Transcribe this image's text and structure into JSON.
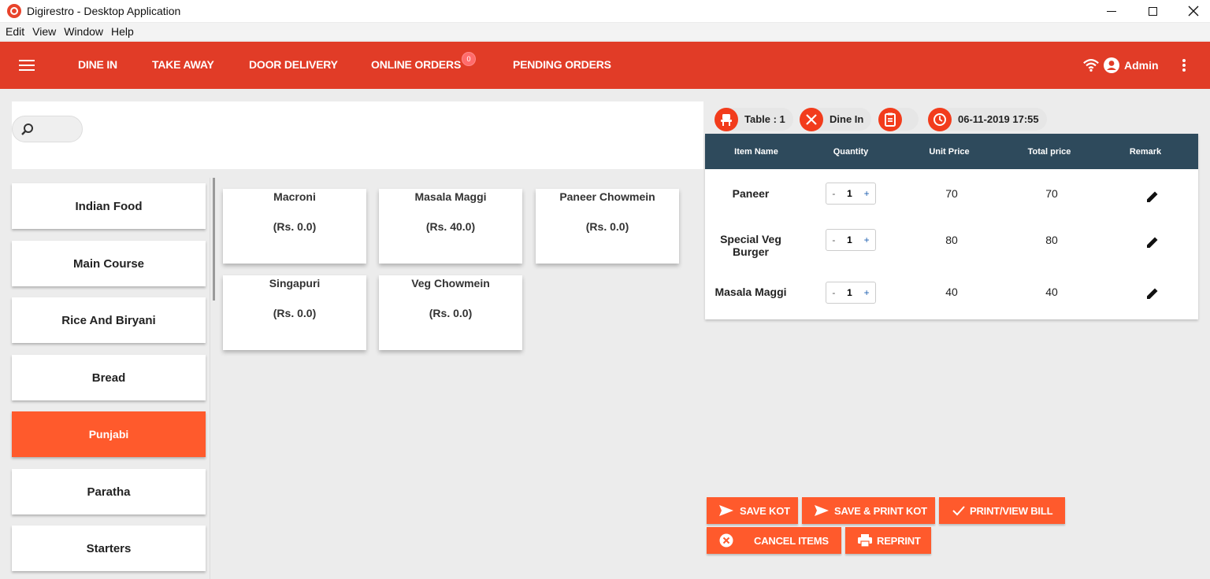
{
  "window": {
    "title": "Digirestro - Desktop Application"
  },
  "menu": [
    "Edit",
    "View",
    "Window",
    "Help"
  ],
  "nav": {
    "tabs": [
      "DINE IN",
      "TAKE AWAY",
      "DOOR DELIVERY",
      "ONLINE ORDERS",
      "PENDING ORDERS"
    ],
    "online_badge": "0",
    "user": "Admin"
  },
  "categories": [
    "Indian Food",
    "Main Course",
    "Rice And Biryani",
    "Bread",
    "Punjabi",
    "Paratha",
    "Starters"
  ],
  "active_category": "Punjabi",
  "products": [
    {
      "name": "Macroni",
      "price": "(Rs. 0.0)"
    },
    {
      "name": "Masala Maggi",
      "price": "(Rs. 40.0)"
    },
    {
      "name": "Paneer Chowmein",
      "price": "(Rs. 0.0)"
    },
    {
      "name": "Singapuri",
      "price": "(Rs. 0.0)"
    },
    {
      "name": "Veg Chowmein",
      "price": "(Rs. 0.0)"
    }
  ],
  "order_info": {
    "table": "Table : 1",
    "mode": "Dine In",
    "datetime": "06-11-2019 17:55"
  },
  "order_table": {
    "headers": [
      "Item Name",
      "Quantity",
      "Unit Price",
      "Total price",
      "Remark"
    ],
    "rows": [
      {
        "name": "Paneer",
        "qty": "1",
        "unit": "70",
        "total": "70"
      },
      {
        "name": "Special Veg Burger",
        "qty": "1",
        "unit": "80",
        "total": "80"
      },
      {
        "name": "Masala Maggi",
        "qty": "1",
        "unit": "40",
        "total": "40"
      }
    ]
  },
  "actions": {
    "save_kot": "SAVE KOT",
    "save_print_kot": "SAVE & PRINT KOT",
    "print_view_bill": "PRINT/VIEW BILL",
    "cancel_items": "CANCEL ITEMS",
    "reprint": "REPRINT"
  },
  "colors": {
    "brand_red": "#e13c27",
    "accent_orange": "#ff5a2c",
    "table_header": "#2e4a5c"
  },
  "stepper": {
    "minus": "-",
    "plus": "+"
  }
}
